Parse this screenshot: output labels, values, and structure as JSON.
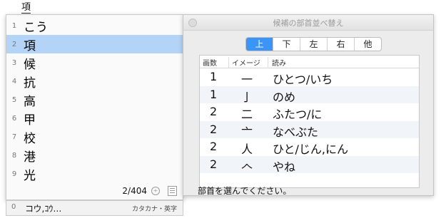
{
  "preedit": "項",
  "candidates": {
    "items": [
      {
        "num": "1",
        "text": "こう"
      },
      {
        "num": "2",
        "text": "項"
      },
      {
        "num": "3",
        "text": "候"
      },
      {
        "num": "4",
        "text": "抗"
      },
      {
        "num": "5",
        "text": "高"
      },
      {
        "num": "6",
        "text": "甲"
      },
      {
        "num": "7",
        "text": "校"
      },
      {
        "num": "8",
        "text": "港"
      },
      {
        "num": "9",
        "text": "光"
      }
    ],
    "selected_index": 1,
    "count": "2/404",
    "zoom_icon": "zoom-in-icon",
    "list_icon": "list-icon"
  },
  "modebar": {
    "num": "0",
    "reading": "コウ,ｺｳ…",
    "mode": "カタカナ・英字"
  },
  "panel": {
    "title": "候補の部首並べ替え",
    "segments": [
      "上",
      "下",
      "左",
      "右",
      "他"
    ],
    "selected_segment": 0,
    "columns": [
      "画数",
      "イメージ",
      "読み"
    ],
    "rows": [
      {
        "strokes": "1",
        "image": "一",
        "reading": "ひとつ/いち"
      },
      {
        "strokes": "1",
        "image": "亅",
        "reading": "のめ"
      },
      {
        "strokes": "2",
        "image": "二",
        "reading": "ふたつ/に"
      },
      {
        "strokes": "2",
        "image": "亠",
        "reading": "なべぶた"
      },
      {
        "strokes": "2",
        "image": "人",
        "reading": "ひと/じん,にん"
      },
      {
        "strokes": "2",
        "image": "𠆢",
        "reading": "やね"
      },
      {
        "strokes": "",
        "image": "",
        "reading": ""
      }
    ],
    "status": "部首を選んでください。"
  }
}
